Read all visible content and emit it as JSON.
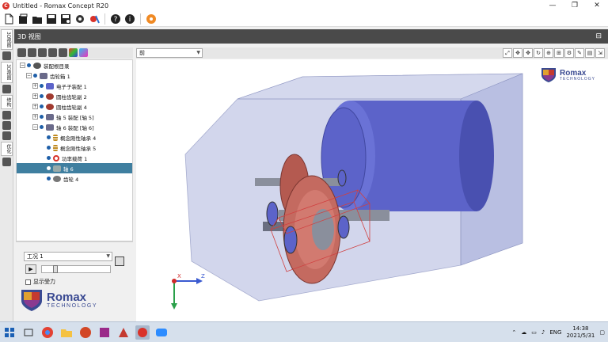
{
  "window": {
    "title": "Untitled - Romax Concept R20",
    "controls": [
      "—",
      "❐",
      "✕"
    ]
  },
  "toolbar": {
    "icons": [
      "new-file-icon",
      "new-project-icon",
      "open-folder-icon",
      "save-icon",
      "save-as-icon",
      "gearbox-icon",
      "model-check-icon",
      "help-icon",
      "info-icon",
      "settings-gear-icon"
    ]
  },
  "side_tabs": [
    "3D视图",
    "3D视图",
    "结构",
    "优化"
  ],
  "view": {
    "panel_title": "3D 视图",
    "view_direction": "前",
    "brand_name": "Romax",
    "brand_sub": "TECHNOLOGY",
    "axis_x": "X",
    "axis_z": "Z"
  },
  "tree": {
    "items": [
      {
        "label": "装配根目录",
        "icon": "assembly-root-icon"
      },
      {
        "label": "齿轮箱 1",
        "icon": "gearbox-icon"
      },
      {
        "label": "电子子装配 1",
        "icon": "electric-sub-assembly-icon"
      },
      {
        "label": "圆柱齿轮副 2",
        "icon": "gear-pair-icon"
      },
      {
        "label": "圆柱齿轮副 4",
        "icon": "gear-pair-icon"
      },
      {
        "label": "轴 5 装配 [轴 5]",
        "icon": "shaft-assembly-icon"
      },
      {
        "label": "轴 6 装配 [轴 6]",
        "icon": "shaft-assembly-icon"
      },
      {
        "label": "概念刚性轴承 4",
        "icon": "bearing-icon"
      },
      {
        "label": "概念刚性轴承 5",
        "icon": "bearing-icon"
      },
      {
        "label": "功率载荷 1",
        "icon": "power-load-icon"
      },
      {
        "label": "轴 6",
        "icon": "shaft-icon"
      },
      {
        "label": "齿轮 4",
        "icon": "gear-icon"
      }
    ]
  },
  "analysis": {
    "load_case": "工况 1",
    "show_load_label": "显示受力",
    "slider_position": 0.17
  },
  "taskbar": {
    "apps": [
      "windows-start-icon",
      "task-view-icon",
      "chrome-icon",
      "file-explorer-icon",
      "powerpoint-icon",
      "app-icon",
      "app-icon",
      "romax-icon",
      "zoom-icon"
    ],
    "language": "ENG",
    "time": "14:38",
    "date": "2021/5/31"
  },
  "colors": {
    "title_accent": "#d9322a",
    "panel_header": "#4a4a4a",
    "tree_selection": "#3f7fa0",
    "housing_fill": "#b8c0e0",
    "motor_fill": "#5c63c9",
    "gear_fill": "#c46a60"
  }
}
